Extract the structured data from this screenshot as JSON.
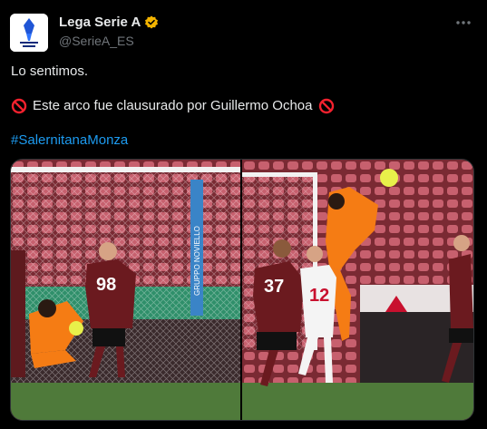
{
  "account": {
    "display_name": "Lega Serie A",
    "handle": "@SerieA_ES",
    "avatar_icon": "serie-a-logo-icon",
    "verified_color": "#f4b400"
  },
  "tweet": {
    "line1": "Lo sentimos.",
    "line2": "Este arco fue clausurado por Guillermo Ochoa",
    "hashtag": "#SalernitanaMonza"
  },
  "photos": {
    "left": {
      "player_number": "98",
      "sponsor": "GRUPPO NOVIELLO"
    },
    "right": {
      "player_number_1": "37",
      "player_number_2": "12"
    }
  },
  "colors": {
    "background": "#000000",
    "text": "#e7e9ea",
    "muted": "#71767b",
    "link": "#1d9bf0",
    "salernitana": "#6b1a1f",
    "keeper": "#f57c14",
    "pitch": "#4f7a3a"
  }
}
